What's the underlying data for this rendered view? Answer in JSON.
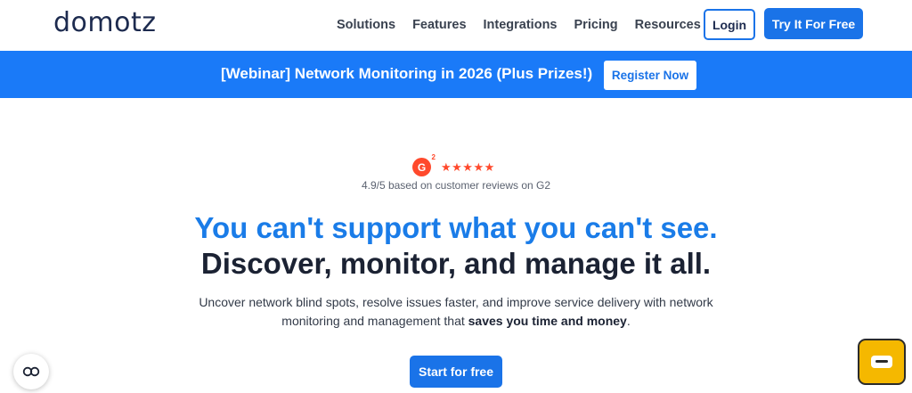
{
  "header": {
    "logo": "domotz",
    "nav": [
      "Solutions",
      "Features",
      "Integrations",
      "Pricing",
      "Resources"
    ],
    "login_label": "Login",
    "try_label": "Try It For Free"
  },
  "banner": {
    "text": "[Webinar] Network Monitoring in 2026 (Plus Prizes!)",
    "register_label": "Register Now"
  },
  "hero": {
    "g2_logo": "G",
    "g2_sup": "2",
    "stars": "★★★★★",
    "rating_text": "4.9/5 based on customer reviews on G2",
    "headline_1": "You can't support what you can't see.",
    "headline_2": "Discover, monitor, and manage it all.",
    "desc_1": "Uncover network blind spots, resolve issues faster, and improve service delivery with network monitoring and management that ",
    "desc_bold": "saves you time and money",
    "desc_end": ".",
    "cta_label": "Start for free"
  },
  "widgets": {
    "cookie_icon": "cookie-consent-icon",
    "chat_icon": "chat-icon"
  },
  "colors": {
    "accent": "#1a73e8",
    "banner": "#1a7af8",
    "g2": "#ff492c",
    "chat": "#f5b800"
  }
}
